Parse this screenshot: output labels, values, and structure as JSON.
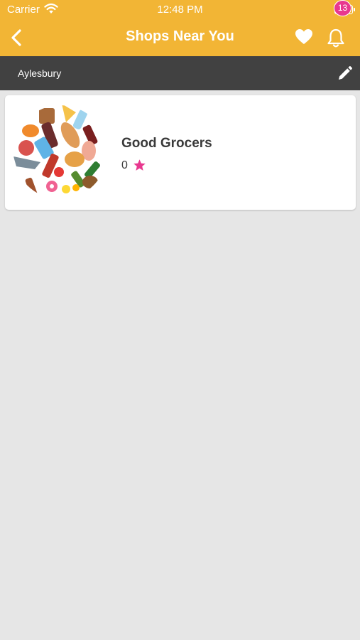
{
  "status_bar": {
    "carrier": "Carrier",
    "time": "12:48 PM"
  },
  "nav": {
    "title": "Shops Near You",
    "notification_count": "13",
    "back_icon": "chevron-left-icon",
    "favorite_icon": "heart-icon",
    "notification_icon": "bell-icon"
  },
  "location": {
    "name": "Aylesbury",
    "edit_icon": "pencil-icon"
  },
  "shops": [
    {
      "name": "Good Grocers",
      "rating": "0"
    }
  ],
  "colors": {
    "header": "#f2b535",
    "location_bar": "#414141",
    "background": "#e6e6e6",
    "badge": "#e8388f",
    "star": "#e8388f"
  }
}
